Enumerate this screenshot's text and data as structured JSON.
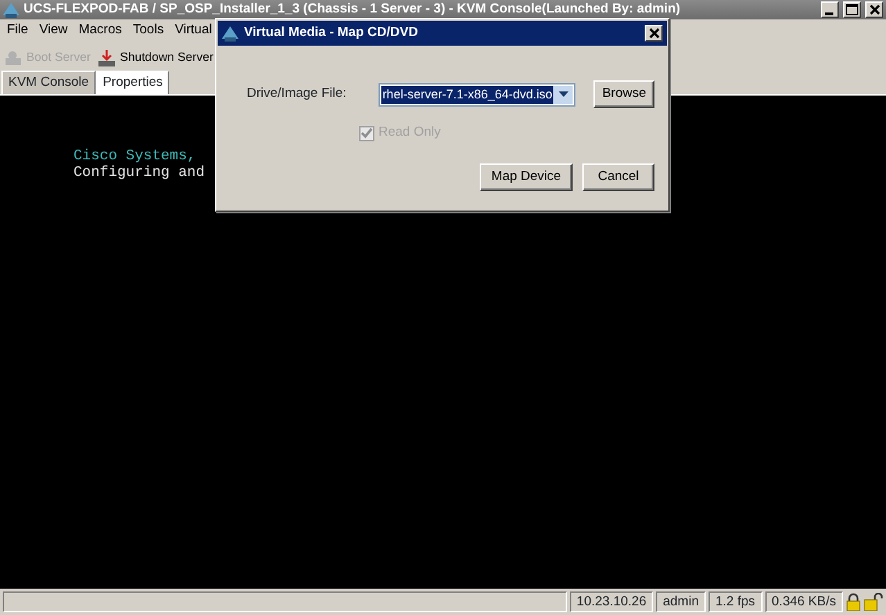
{
  "window": {
    "title": "UCS-FLEXPOD-FAB / SP_OSP_Installer_1_3 (Chassis - 1 Server - 3) - KVM Console(Launched By: admin)"
  },
  "menu": [
    "File",
    "View",
    "Macros",
    "Tools",
    "Virtual"
  ],
  "toolbar": [
    {
      "label": "Boot Server",
      "disabled": true
    },
    {
      "label": "Shutdown Server",
      "disabled": false
    }
  ],
  "tabs": [
    {
      "label": "KVM Console",
      "selected": true
    },
    {
      "label": "Properties",
      "selected": false
    }
  ],
  "console": [
    {
      "text": "Cisco Systems,",
      "color": "#3fb8b8"
    },
    {
      "text": "Configuring and",
      "color": "#e4e4e4"
    }
  ],
  "status_bar": [
    "10.23.10.26",
    "admin",
    "1.2 fps",
    "0.346 KB/s"
  ],
  "dialog": {
    "title": "Virtual Media - Map CD/DVD",
    "field_label": "Drive/Image File:",
    "value": "rhel-server-7.1-x86_64-dvd.iso",
    "browse": "Browse",
    "read_only": {
      "label": "Read Only",
      "checked": true,
      "disabled": true
    },
    "buttons": [
      "Map Device",
      "Cancel"
    ]
  }
}
